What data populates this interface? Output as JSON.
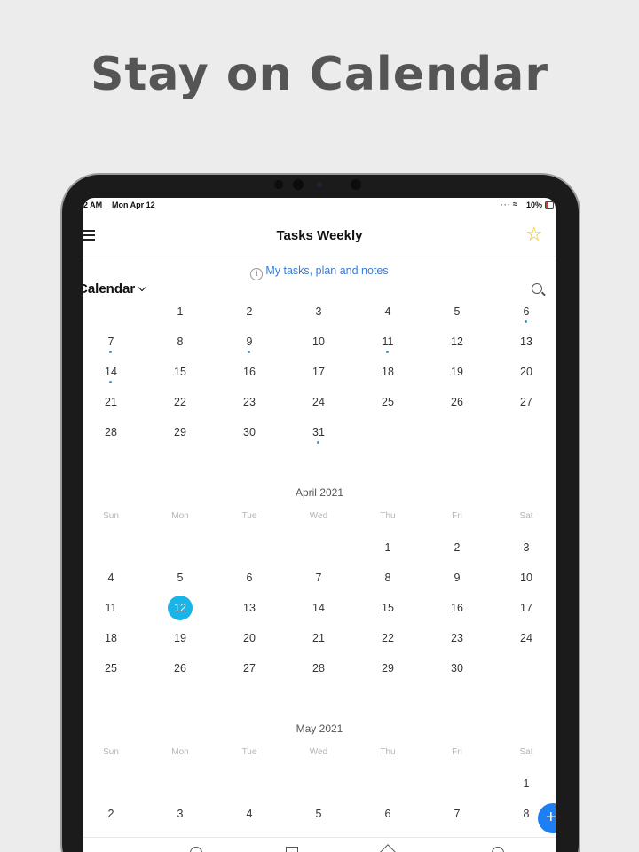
{
  "headline": "Stay on Calendar",
  "status": {
    "time": "2 AM",
    "date": "Mon Apr 12",
    "battery": "10%"
  },
  "app": {
    "title": "Tasks Weekly",
    "info_link": "My tasks, plan and notes",
    "section_title": "Calendar"
  },
  "colors": {
    "accent": "#19b4e8",
    "link": "#3a7bd5",
    "star": "#f2c400",
    "fab": "#1e7ff5"
  },
  "icons": [
    "menu-icon",
    "star-icon",
    "info-icon",
    "chevron-down-icon",
    "search-icon",
    "add-icon"
  ],
  "weekdays": [
    "Sun",
    "Mon",
    "Tue",
    "Wed",
    "Thu",
    "Fri",
    "Sat"
  ],
  "months": [
    {
      "name": "",
      "show_header": false,
      "weeks": [
        [
          {
            "d": ""
          },
          {
            "d": "1"
          },
          {
            "d": "2"
          },
          {
            "d": "3"
          },
          {
            "d": "4"
          },
          {
            "d": "5"
          },
          {
            "d": "6",
            "dot": true
          }
        ],
        [
          {
            "d": "7",
            "dot": true
          },
          {
            "d": "8"
          },
          {
            "d": "9",
            "dot": true
          },
          {
            "d": "10"
          },
          {
            "d": "11",
            "dot": true
          },
          {
            "d": "12"
          },
          {
            "d": "13"
          }
        ],
        [
          {
            "d": "14",
            "dot": true
          },
          {
            "d": "15"
          },
          {
            "d": "16"
          },
          {
            "d": "17"
          },
          {
            "d": "18"
          },
          {
            "d": "19"
          },
          {
            "d": "20"
          }
        ],
        [
          {
            "d": "21"
          },
          {
            "d": "22"
          },
          {
            "d": "23"
          },
          {
            "d": "24"
          },
          {
            "d": "25"
          },
          {
            "d": "26"
          },
          {
            "d": "27"
          }
        ],
        [
          {
            "d": "28"
          },
          {
            "d": "29"
          },
          {
            "d": "30"
          },
          {
            "d": "31",
            "dot": true
          },
          {
            "d": ""
          },
          {
            "d": ""
          },
          {
            "d": ""
          }
        ]
      ]
    },
    {
      "name": "April 2021",
      "show_header": true,
      "weeks": [
        [
          {
            "d": ""
          },
          {
            "d": ""
          },
          {
            "d": ""
          },
          {
            "d": ""
          },
          {
            "d": "1"
          },
          {
            "d": "2"
          },
          {
            "d": "3"
          }
        ],
        [
          {
            "d": "4"
          },
          {
            "d": "5"
          },
          {
            "d": "6"
          },
          {
            "d": "7"
          },
          {
            "d": "8"
          },
          {
            "d": "9"
          },
          {
            "d": "10"
          }
        ],
        [
          {
            "d": "11"
          },
          {
            "d": "12",
            "today": true
          },
          {
            "d": "13"
          },
          {
            "d": "14"
          },
          {
            "d": "15"
          },
          {
            "d": "16"
          },
          {
            "d": "17"
          }
        ],
        [
          {
            "d": "18"
          },
          {
            "d": "19"
          },
          {
            "d": "20"
          },
          {
            "d": "21"
          },
          {
            "d": "22"
          },
          {
            "d": "23"
          },
          {
            "d": "24"
          }
        ],
        [
          {
            "d": "25"
          },
          {
            "d": "26"
          },
          {
            "d": "27"
          },
          {
            "d": "28"
          },
          {
            "d": "29"
          },
          {
            "d": "30"
          },
          {
            "d": ""
          }
        ]
      ]
    },
    {
      "name": "May 2021",
      "show_header": true,
      "weeks": [
        [
          {
            "d": ""
          },
          {
            "d": ""
          },
          {
            "d": ""
          },
          {
            "d": ""
          },
          {
            "d": ""
          },
          {
            "d": ""
          },
          {
            "d": "1"
          }
        ],
        [
          {
            "d": "2"
          },
          {
            "d": "3"
          },
          {
            "d": "4"
          },
          {
            "d": "5"
          },
          {
            "d": "6"
          },
          {
            "d": "7"
          },
          {
            "d": "8"
          }
        ]
      ]
    }
  ]
}
